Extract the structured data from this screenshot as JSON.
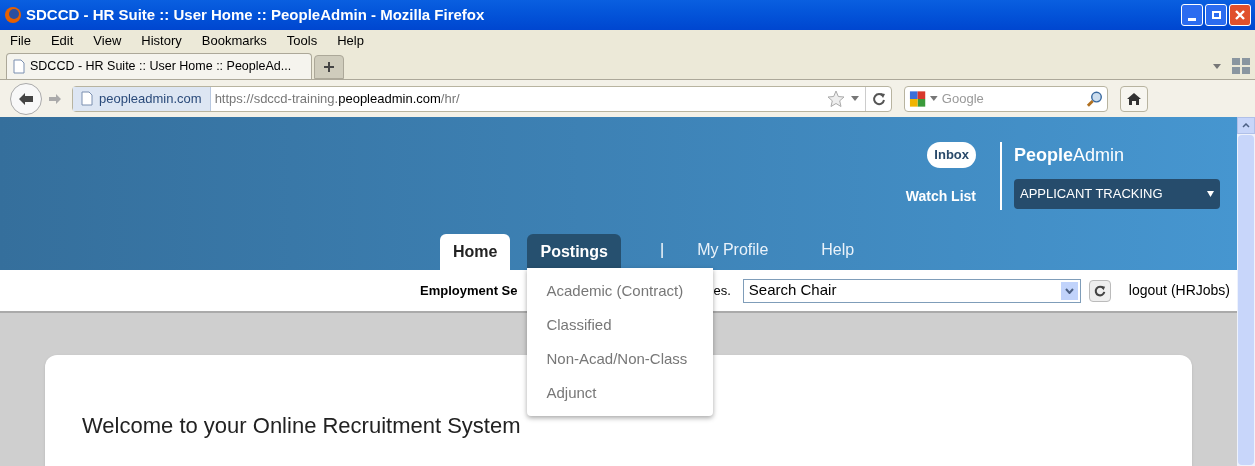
{
  "window": {
    "title": "SDCCD - HR Suite :: User Home :: PeopleAdmin - Mozilla Firefox"
  },
  "menu": [
    "File",
    "Edit",
    "View",
    "History",
    "Bookmarks",
    "Tools",
    "Help"
  ],
  "browser_tabs": [
    {
      "label": "SDCCD - HR Suite :: User Home :: PeopleAd...",
      "selected": true
    }
  ],
  "address_bar": {
    "identity": "peopleadmin.com",
    "url_parts": [
      {
        "text": "https://sdccd-training.",
        "kind": "dim"
      },
      {
        "text": "peopleadmin.com",
        "kind": "domain"
      },
      {
        "text": "/hr/",
        "kind": "dim"
      }
    ]
  },
  "search_bar": {
    "placeholder": "Google"
  },
  "site": {
    "inbox": "Inbox",
    "watch_list": "Watch List",
    "logo_bold": "People",
    "logo_light": "Admin",
    "product_select": "APPLICANT TRACKING",
    "nav": [
      {
        "label": "Home",
        "kind": "tab",
        "selected": true,
        "expanded": false
      },
      {
        "label": "Postings",
        "kind": "tab",
        "selected": false,
        "expanded": true
      },
      {
        "label": "|",
        "kind": "separator"
      },
      {
        "label": "My Profile",
        "kind": "link"
      },
      {
        "label": "Help",
        "kind": "link"
      }
    ],
    "dropdown": [
      "Academic (Contract)",
      "Classified",
      "Non-Acad/Non-Class",
      "Adjunct"
    ],
    "employment_text": [
      "Employment Se",
      "es."
    ],
    "search_select": "Search Chair",
    "logout": "logout (HRJobs)",
    "welcome": "Welcome to your Online Recruitment System"
  }
}
